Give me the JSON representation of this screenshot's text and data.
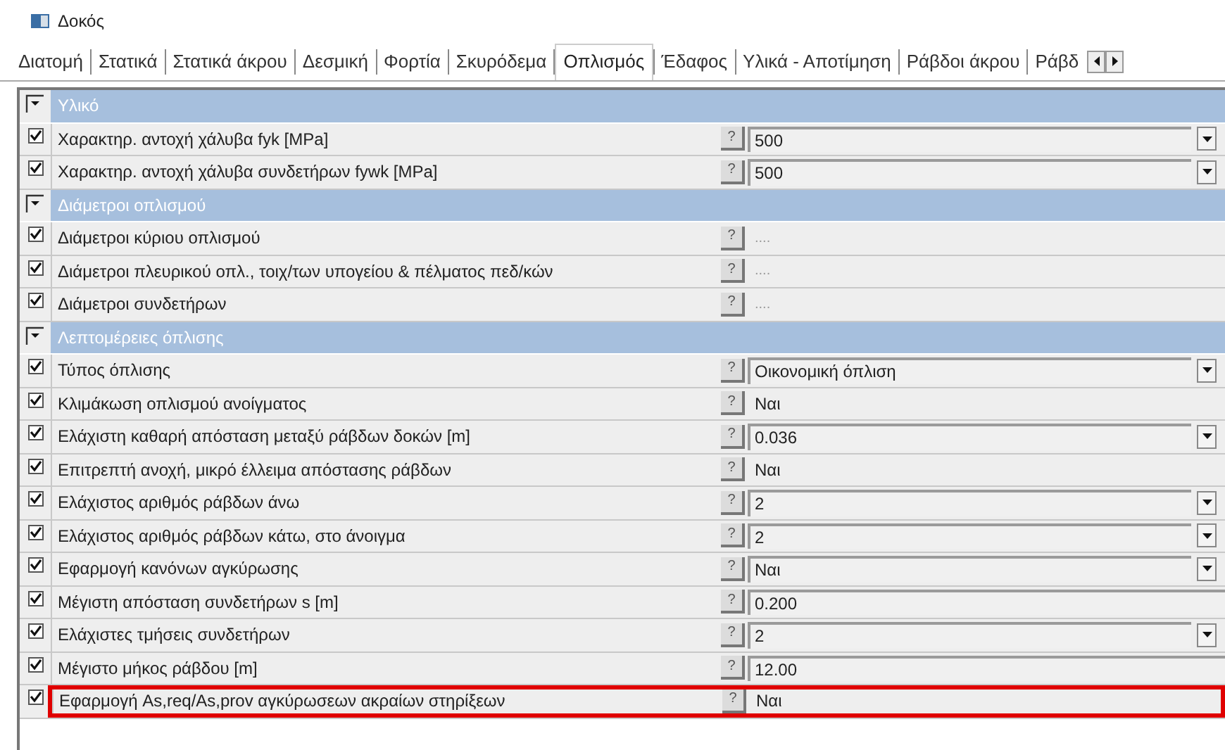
{
  "window": {
    "title": "Δοκός"
  },
  "tabs": [
    {
      "label": "Διατομή",
      "selected": false
    },
    {
      "label": "Στατικά",
      "selected": false
    },
    {
      "label": "Στατικά άκρου",
      "selected": false
    },
    {
      "label": "Δεσμική",
      "selected": false
    },
    {
      "label": "Φορτία",
      "selected": false
    },
    {
      "label": "Σκυρόδεμα",
      "selected": false
    },
    {
      "label": "Οπλισμός",
      "selected": true
    },
    {
      "label": "Έδαφος",
      "selected": false
    },
    {
      "label": "Υλικά - Αποτίμηση",
      "selected": false
    },
    {
      "label": "Ράβδοι άκρου",
      "selected": false
    },
    {
      "label": "Ράβδ",
      "selected": false
    }
  ],
  "rows": [
    {
      "kind": "group",
      "label": "Υλικό",
      "expanded": true
    },
    {
      "kind": "combo",
      "checked": true,
      "label": "Χαρακτηρ. αντοχή χάλυβα fyk [MPa]",
      "help": "?",
      "value": "500",
      "highlighted": false
    },
    {
      "kind": "combo",
      "checked": true,
      "label": "Χαρακτηρ. αντοχή χάλυβα συνδετήρων fywk [MPa]",
      "help": "?",
      "value": "500",
      "highlighted": false
    },
    {
      "kind": "group",
      "label": "Διάμετροι οπλισμού",
      "expanded": true
    },
    {
      "kind": "dialog",
      "checked": true,
      "label": "Διάμετροι κύριου οπλισμού",
      "help": "?",
      "value": "....",
      "highlighted": false
    },
    {
      "kind": "dialog",
      "checked": true,
      "label": "Διάμετροι πλευρικού οπλ., τοιχ/των υπογείου & πέλματος πεδ/κών",
      "help": "?",
      "value": "....",
      "highlighted": false
    },
    {
      "kind": "dialog",
      "checked": true,
      "label": "Διάμετροι συνδετήρων",
      "help": "?",
      "value": "....",
      "highlighted": false
    },
    {
      "kind": "group",
      "label": "Λεπτομέρειες όπλισης",
      "expanded": true
    },
    {
      "kind": "combo",
      "checked": true,
      "label": "Τύπος όπλισης",
      "help": "?",
      "value": "Οικονομική όπλιση",
      "highlighted": false
    },
    {
      "kind": "plain",
      "checked": true,
      "label": "Κλιμάκωση οπλισμού ανοίγματος",
      "help": "?",
      "value": "Ναι",
      "highlighted": false
    },
    {
      "kind": "combo",
      "checked": true,
      "label": "Ελάχιστη καθαρή απόσταση μεταξύ ράβδων δοκών [m]",
      "help": "?",
      "value": "0.036",
      "highlighted": false
    },
    {
      "kind": "plain",
      "checked": true,
      "label": "Επιτρεπτή ανοχή, μικρό έλλειμα απόστασης ράβδων",
      "help": "?",
      "value": "Ναι",
      "highlighted": false
    },
    {
      "kind": "combo",
      "checked": true,
      "label": "Ελάχιστος αριθμός ράβδων άνω",
      "help": "?",
      "value": "2",
      "highlighted": false
    },
    {
      "kind": "combo",
      "checked": true,
      "label": "Ελάχιστος αριθμός ράβδων κάτω, στο άνοιγμα",
      "help": "?",
      "value": "2",
      "highlighted": false
    },
    {
      "kind": "combo",
      "checked": true,
      "label": "Εφαρμογή κανόνων αγκύρωσης",
      "help": "?",
      "value": "Ναι",
      "highlighted": false
    },
    {
      "kind": "edit",
      "checked": true,
      "label": "Μέγιστη απόσταση συνδετήρων s [m]",
      "help": "?",
      "value": "0.200",
      "highlighted": false
    },
    {
      "kind": "combo",
      "checked": true,
      "label": "Ελάχιστες τμήσεις συνδετήρων",
      "help": "?",
      "value": "2",
      "highlighted": false
    },
    {
      "kind": "edit",
      "checked": true,
      "label": "Μέγιστο μήκος ράβδου [m]",
      "help": "?",
      "value": "12.00",
      "highlighted": false
    },
    {
      "kind": "plain",
      "checked": true,
      "label": "Εφαρμογή As,req/As,prov αγκύρωσεων ακραίων στηρίξεων",
      "help": "?",
      "value": "Ναι",
      "highlighted": true
    }
  ]
}
